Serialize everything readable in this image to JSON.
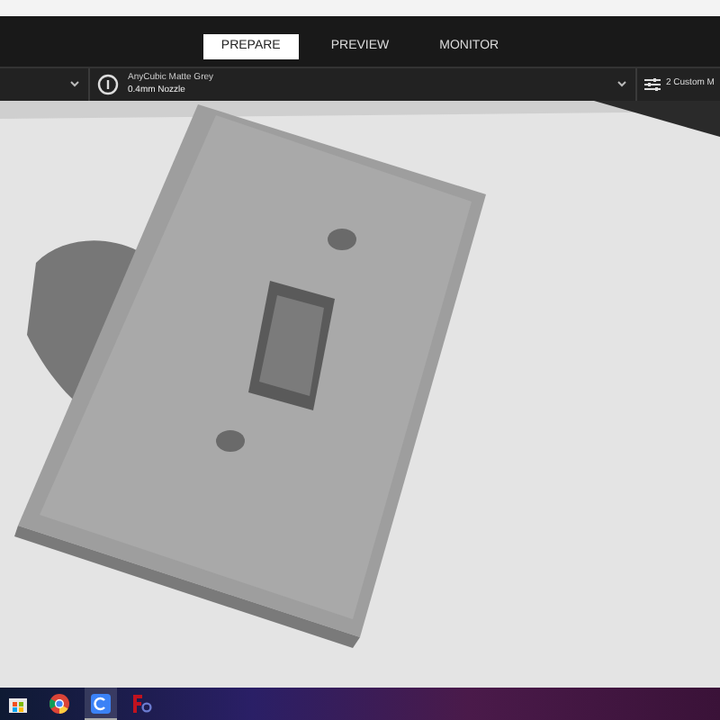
{
  "tabs": [
    {
      "label": "PREPARE",
      "selected": true
    },
    {
      "label": "PREVIEW",
      "selected": false
    },
    {
      "label": "MONITOR",
      "selected": false
    }
  ],
  "material": {
    "name": "AnyCubic Matte Grey",
    "nozzle": "0.4mm Nozzle"
  },
  "settings": {
    "label": "2 Custom M"
  },
  "taskbar": {
    "apps": [
      {
        "kind": "store",
        "active": false
      },
      {
        "kind": "browser",
        "active": false
      },
      {
        "kind": "slicer",
        "active": true
      },
      {
        "kind": "viewer",
        "active": false
      }
    ]
  }
}
